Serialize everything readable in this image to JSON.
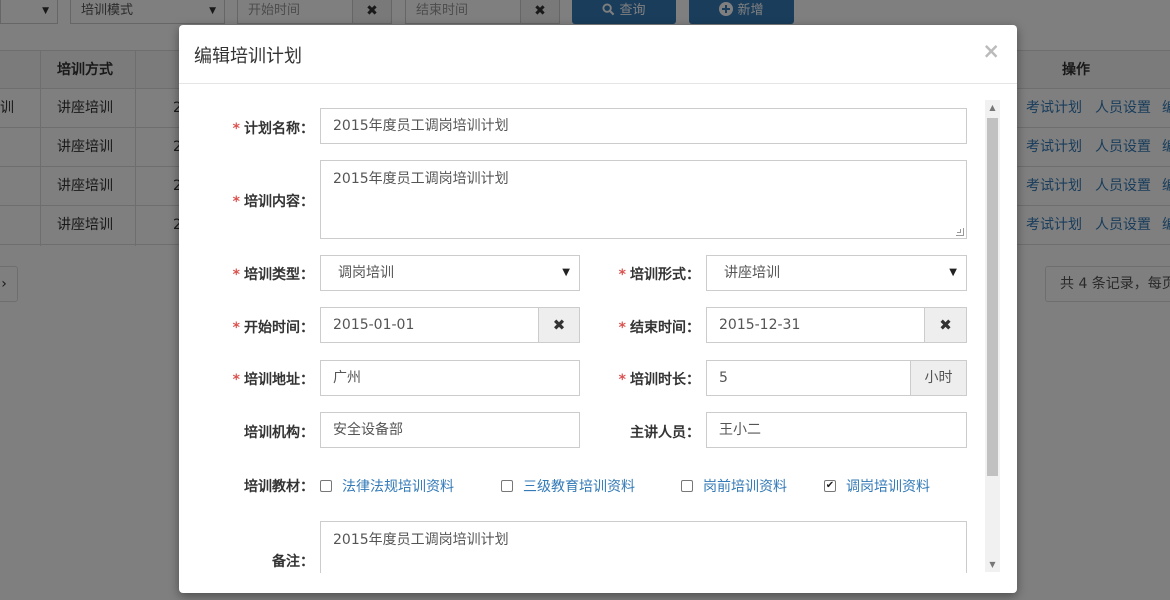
{
  "background": {
    "toolbar": {
      "mode_select": "培训模式",
      "start_placeholder": "开始时间",
      "end_placeholder": "结束时间",
      "clear_symbol": "✖",
      "search_label": "查询",
      "add_label": "新增"
    },
    "grid": {
      "col_mode_header": "培训方式",
      "col_ops_header": "操作",
      "rows": [
        {
          "left_fragment": "训",
          "mode": "讲座培训",
          "frag2": "2",
          "op1": "考试计划",
          "op2": "人员设置",
          "op3": "编"
        },
        {
          "left_fragment": "",
          "mode": "讲座培训",
          "frag2": "2",
          "op1": "考试计划",
          "op2": "人员设置",
          "op3": "编"
        },
        {
          "left_fragment": "",
          "mode": "讲座培训",
          "frag2": "2",
          "op1": "考试计划",
          "op2": "人员设置",
          "op3": "编"
        },
        {
          "left_fragment": "",
          "mode": "讲座培训",
          "frag2": "2",
          "op1": "考试计划",
          "op2": "人员设置",
          "op3": "编"
        }
      ]
    },
    "pager": {
      "prev_symbol": "›",
      "summary": "共 4 条记录，每页"
    }
  },
  "modal": {
    "title": "编辑培训计划",
    "close_symbol": "×",
    "required_mark": "*",
    "fields": {
      "plan_name": {
        "label": "计划名称：",
        "value": "2015年度员工调岗培训计划"
      },
      "content": {
        "label": "培训内容：",
        "value": "2015年度员工调岗培训计划"
      },
      "type": {
        "label": "培训类型：",
        "value": "调岗培训"
      },
      "form": {
        "label": "培训形式：",
        "value": "讲座培训"
      },
      "start": {
        "label": "开始时间：",
        "value": "2015-01-01"
      },
      "end": {
        "label": "结束时间：",
        "value": "2015-12-31"
      },
      "address": {
        "label": "培训地址：",
        "value": "广州"
      },
      "duration": {
        "label": "培训时长：",
        "value": "5",
        "unit": "小时"
      },
      "org": {
        "label": "培训机构：",
        "value": "安全设备部"
      },
      "lecturer": {
        "label": "主讲人员：",
        "value": "王小二"
      },
      "materials": {
        "label": "培训教材：",
        "options": [
          {
            "label": "法律法规培训资料",
            "checked": false
          },
          {
            "label": "三级教育培训资料",
            "checked": false
          },
          {
            "label": "岗前培训资料",
            "checked": false
          },
          {
            "label": "调岗培训资料",
            "checked": true
          }
        ]
      },
      "remark": {
        "label": "备注：",
        "value": "2015年度员工调岗培训计划"
      }
    }
  }
}
